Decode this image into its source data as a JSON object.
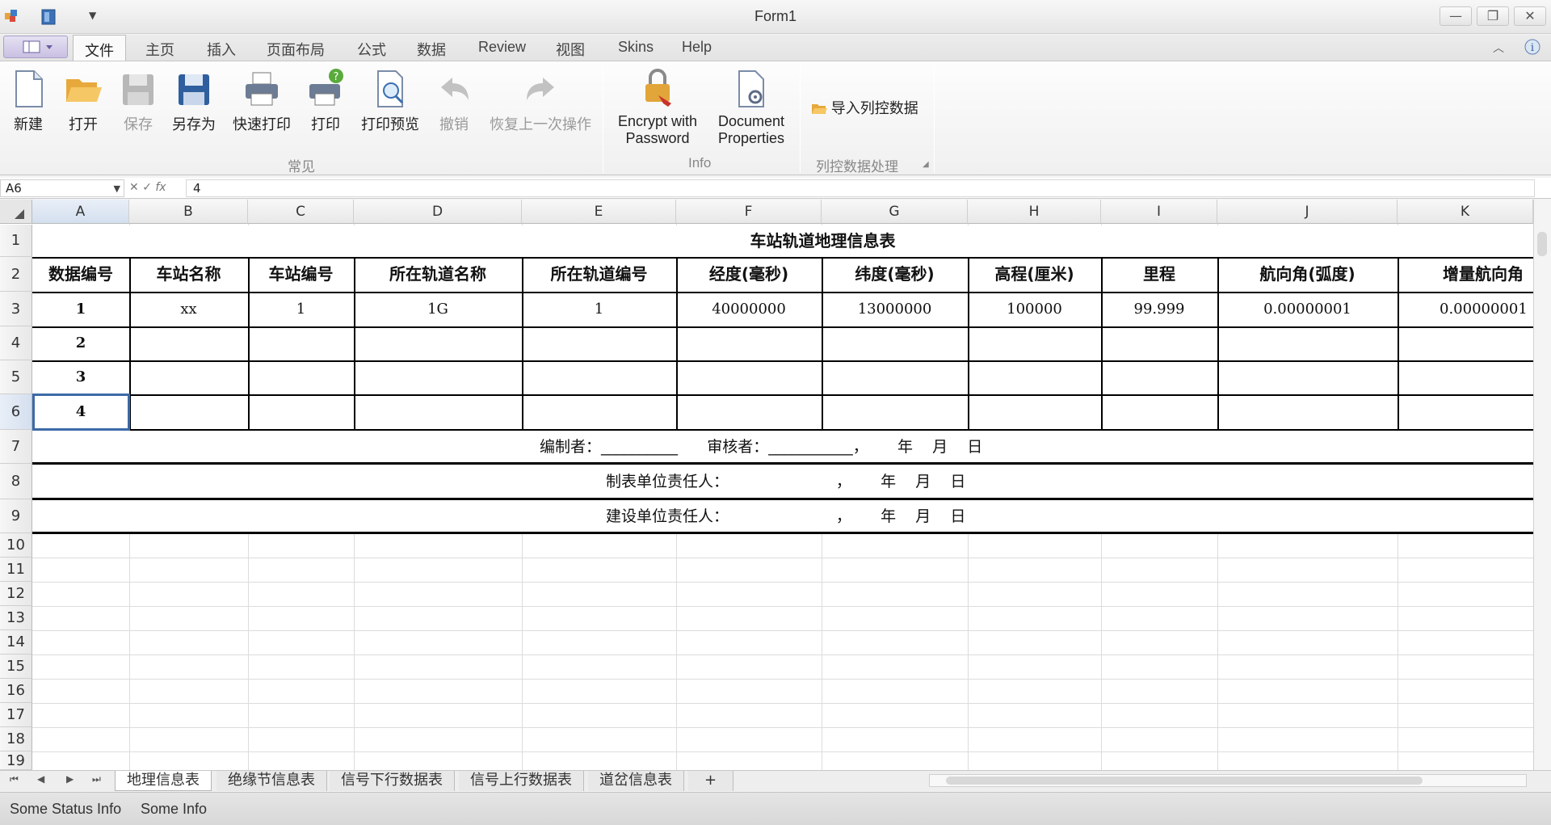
{
  "window": {
    "title": "Form1"
  },
  "tabs": [
    {
      "label": "文件",
      "active": true
    },
    {
      "label": "主页"
    },
    {
      "label": "插入"
    },
    {
      "label": "页面布局"
    },
    {
      "label": "公式"
    },
    {
      "label": "数据"
    },
    {
      "label": "Review"
    },
    {
      "label": "视图"
    },
    {
      "label": "Skins"
    },
    {
      "label": "Help"
    }
  ],
  "ribbon": {
    "groups": {
      "common": "常见",
      "info": "Info",
      "column_control": "列控数据处理"
    },
    "buttons": {
      "new": "新建",
      "open": "打开",
      "save": "保存",
      "save_as": "另存为",
      "quick_print": "快速打印",
      "print": "打印",
      "print_preview": "打印预览",
      "undo": "撤销",
      "redo": "恢复上一次操作",
      "encrypt_line1": "Encrypt with",
      "encrypt_line2": "Password",
      "docprops_line1": "Document",
      "docprops_line2": "Properties",
      "import_column_control": "导入列控数据"
    }
  },
  "formula_bar": {
    "name_box": "A6",
    "formula": "4"
  },
  "columns": [
    "A",
    "B",
    "C",
    "D",
    "E",
    "F",
    "G",
    "H",
    "I",
    "J",
    "K"
  ],
  "rows": [
    "1",
    "2",
    "3",
    "4",
    "5",
    "6",
    "7",
    "8",
    "9",
    "10",
    "11",
    "12",
    "13",
    "14",
    "15",
    "16",
    "17",
    "18",
    "19"
  ],
  "sheet": {
    "title": "车站轨道地理信息表",
    "headers": [
      "数据编号",
      "车站名称",
      "车站编号",
      "所在轨道名称",
      "所在轨道编号",
      "经度(毫秒)",
      "纬度(毫秒)",
      "高程(厘米)",
      "里程",
      "航向角(弧度)",
      "增量航向角"
    ],
    "row3": [
      "1",
      "xx",
      "1",
      "1G",
      "1",
      "40000000",
      "13000000",
      "100000",
      "99.999",
      "0.00000001",
      "0.00000001"
    ],
    "row4": [
      "2"
    ],
    "row5": [
      "3"
    ],
    "row6": [
      "4"
    ],
    "compiler_line": "编制者：__________      审核者：___________，      年    月    日",
    "responsible_line": "制表单位责任人：                      ，      年    月    日",
    "construction_line": "建设单位责任人：                      ，      年    月    日"
  },
  "sheet_tabs": [
    {
      "label": "地理信息表",
      "active": true
    },
    {
      "label": "绝缘节信息表"
    },
    {
      "label": "信号下行数据表"
    },
    {
      "label": "信号上行数据表"
    },
    {
      "label": "道岔信息表"
    },
    {
      "label": "+"
    }
  ],
  "status": {
    "left": "Some Status Info",
    "right": "Some Info"
  }
}
